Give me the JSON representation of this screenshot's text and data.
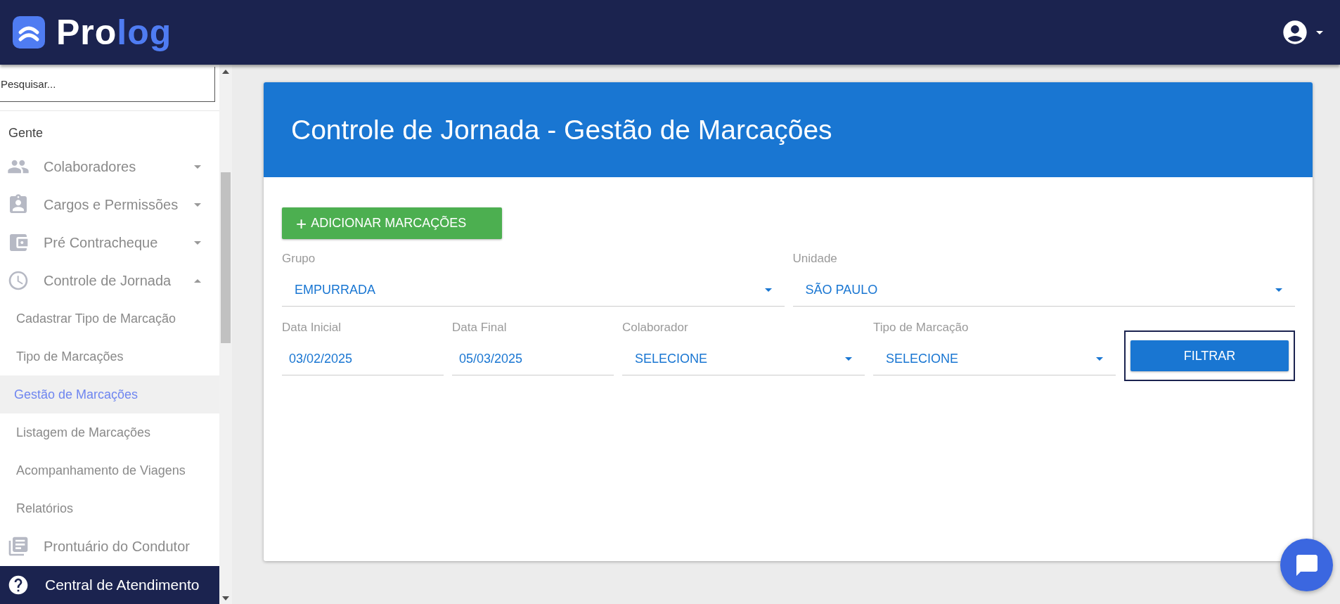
{
  "header": {
    "brand": [
      "Pro",
      "log"
    ]
  },
  "sidebar": {
    "search": {
      "placeholder": "Pesquisar..."
    },
    "items": [
      {
        "kind": "section",
        "label": "Gente"
      },
      {
        "kind": "group",
        "label": "Colaboradores",
        "expanded": false
      },
      {
        "kind": "group",
        "label": "Cargos e Permissões",
        "expanded": false
      },
      {
        "kind": "group",
        "label": "Pré Contracheque",
        "expanded": false
      },
      {
        "kind": "group",
        "label": "Controle de Jornada",
        "expanded": true,
        "children": [
          {
            "label": "Cadastrar Tipo de Marcação",
            "selected": false
          },
          {
            "label": "Tipo de Marcações",
            "selected": false
          },
          {
            "label": "Gestão de Marcações",
            "selected": true
          },
          {
            "label": "Listagem de Marcações",
            "selected": false
          },
          {
            "label": "Acompanhamento de Viagens",
            "selected": false
          },
          {
            "label": "Relatórios",
            "selected": false
          }
        ]
      },
      {
        "kind": "link",
        "label": "Prontuário do Condutor"
      }
    ],
    "footer": {
      "label": "Central de Atendimento"
    }
  },
  "card": {
    "title": "Controle de Jornada - Gestão de Marcações",
    "add_button": {
      "icon_text": "+",
      "label": "ADICIONAR MARCAÇÕES"
    },
    "rows": [
      [
        {
          "kind": "select",
          "label": "Grupo",
          "value": "EMPURRADA"
        },
        {
          "kind": "select",
          "label": "Unidade",
          "value": "SÃO PAULO"
        }
      ],
      [
        {
          "kind": "date",
          "label": "Data Inicial",
          "value": "03/02/2025"
        },
        {
          "kind": "date",
          "label": "Data Final",
          "value": "05/03/2025"
        },
        {
          "kind": "select",
          "label": "Colaborador",
          "value": "SELECIONE"
        },
        {
          "kind": "select",
          "label": "Tipo de Marcação",
          "value": "SELECIONE"
        },
        {
          "kind": "button",
          "label": "FILTRAR",
          "focused": true
        }
      ]
    ]
  }
}
